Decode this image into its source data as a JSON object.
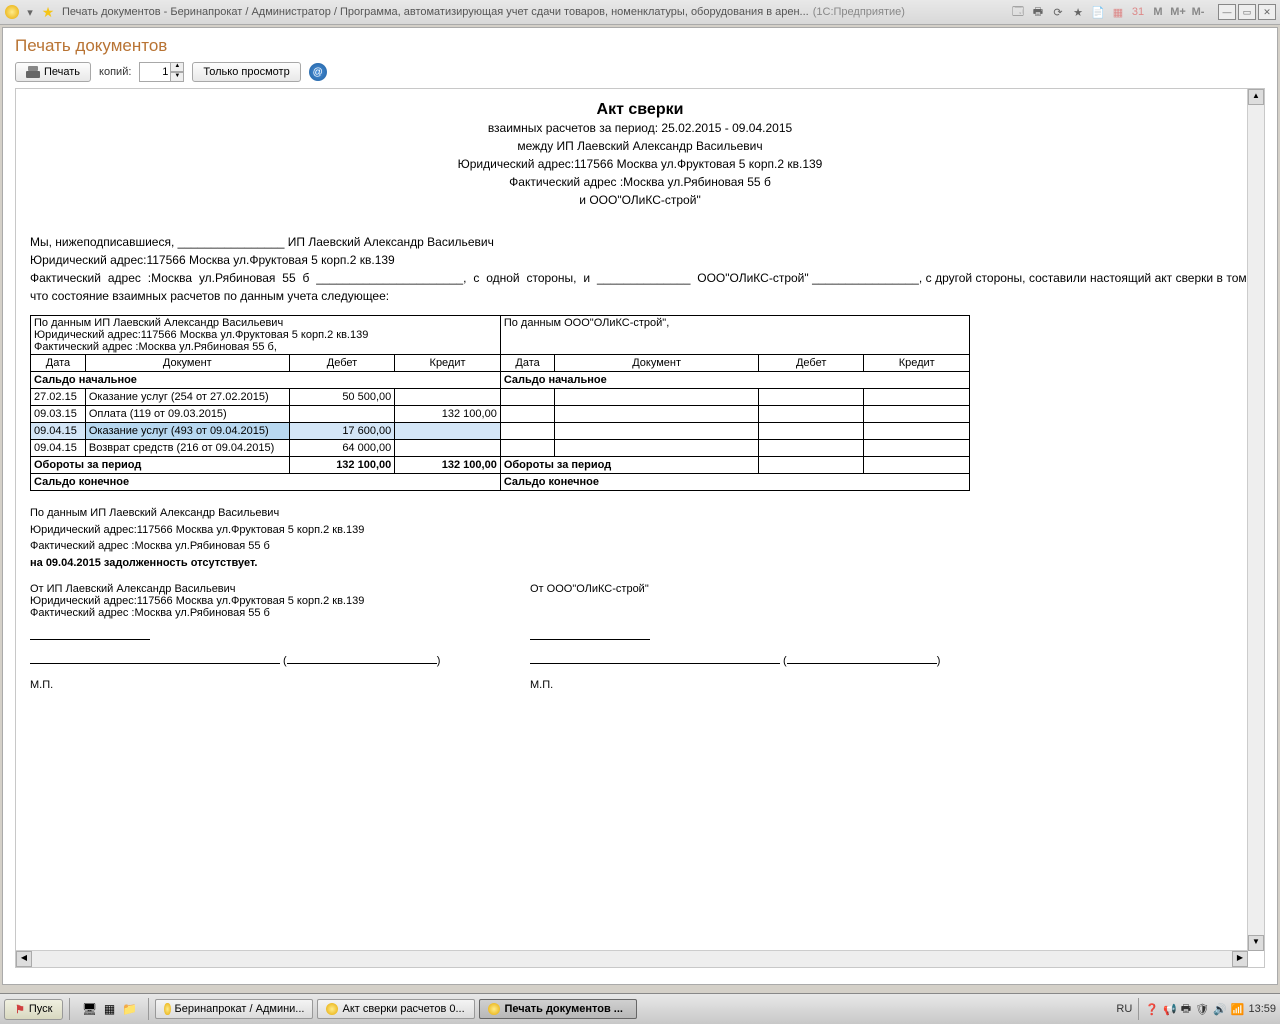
{
  "window": {
    "title": "Печать документов - Беринапрокат / Администратор / Программа, автоматизирующая учет сдачи товаров, номенклатуры, оборудования в арен...",
    "suffix": "(1С:Предприятие)"
  },
  "header_icons": {
    "m": "M",
    "mplus": "M+",
    "mminus": "M-"
  },
  "page": {
    "title": "Печать документов"
  },
  "toolbar": {
    "print": "Печать",
    "copies_label": "копий:",
    "copies_value": "1",
    "preview": "Только просмотр"
  },
  "report": {
    "title": "Акт сверки",
    "line1": "взаимных расчетов за период: 25.02.2015 - 09.04.2015",
    "line2": "между ИП Лаевский Александр Васильевич",
    "line3": "Юридический адрес:117566 Москва ул.Фруктовая 5 корп.2 кв.139",
    "line4": "Фактический адрес :Москва ул.Рябиновая 55 б",
    "line5": "и ООО\"ОЛиКС-строй\"",
    "preamble": "Мы, нижеподписавшиеся, ________________ ИП Лаевский Александр Васильевич\nЮридический адрес:117566 Москва ул.Фруктовая 5 корп.2 кв.139\nФактический адрес :Москва ул.Рябиновая 55 б ______________________, с одной стороны, и ______________ ООО\"ОЛиКС-строй\" ________________, с другой стороны, составили настоящий акт сверки в том, что состояние взаимных расчетов по данным учета следующее:",
    "left_caption1": "По данным ИП Лаевский Александр Васильевич",
    "left_caption2": "Юридический адрес:117566 Москва ул.Фруктовая 5 корп.2 кв.139",
    "left_caption3": "Фактический адрес :Москва ул.Рябиновая 55 б,",
    "right_caption": "По данным ООО\"ОЛиКС-строй\",",
    "cols": {
      "date": "Дата",
      "doc": "Документ",
      "debit": "Дебет",
      "credit": "Кредит"
    },
    "rows": [
      {
        "date": "27.02.15",
        "doc": "Оказание услуг (254 от 27.02.2015)",
        "debit": "50 500,00",
        "credit": ""
      },
      {
        "date": "09.03.15",
        "doc": "Оплата (119 от 09.03.2015)",
        "debit": "",
        "credit": "132 100,00"
      },
      {
        "date": "09.04.15",
        "doc": "Оказание услуг (493 от 09.04.2015)",
        "debit": "17 600,00",
        "credit": ""
      },
      {
        "date": "09.04.15",
        "doc": "Возврат средств (216 от 09.04.2015)",
        "debit": "64 000,00",
        "credit": ""
      }
    ],
    "saldo_start": "Сальдо начальное",
    "turnover": "Обороты за период",
    "turnover_debit": "132 100,00",
    "turnover_credit": "132 100,00",
    "saldo_end": "Сальдо конечное",
    "post1": "По данным ИП Лаевский Александр Васильевич",
    "post2": "Юридический адрес:117566 Москва ул.Фруктовая 5 корп.2 кв.139",
    "post3": "Фактический адрес :Москва ул.Рябиновая 55 б",
    "post4": "на 09.04.2015 задолженность отсутствует.",
    "sig_from_left_1": "От ИП Лаевский Александр Васильевич",
    "sig_from_left_2": "Юридический адрес:117566 Москва ул.Фруктовая 5 корп.2 кв.139",
    "sig_from_left_3": "Фактический адрес :Москва ул.Рябиновая 55 б",
    "sig_from_right": "От ООО\"ОЛиКС-строй\"",
    "mp": "М.П."
  },
  "taskbar": {
    "start": "Пуск",
    "tabs": [
      "Беринапрокат / Админи...",
      "Акт сверки расчетов 0...",
      "Печать документов ..."
    ],
    "lang": "RU",
    "time": "13:59"
  }
}
